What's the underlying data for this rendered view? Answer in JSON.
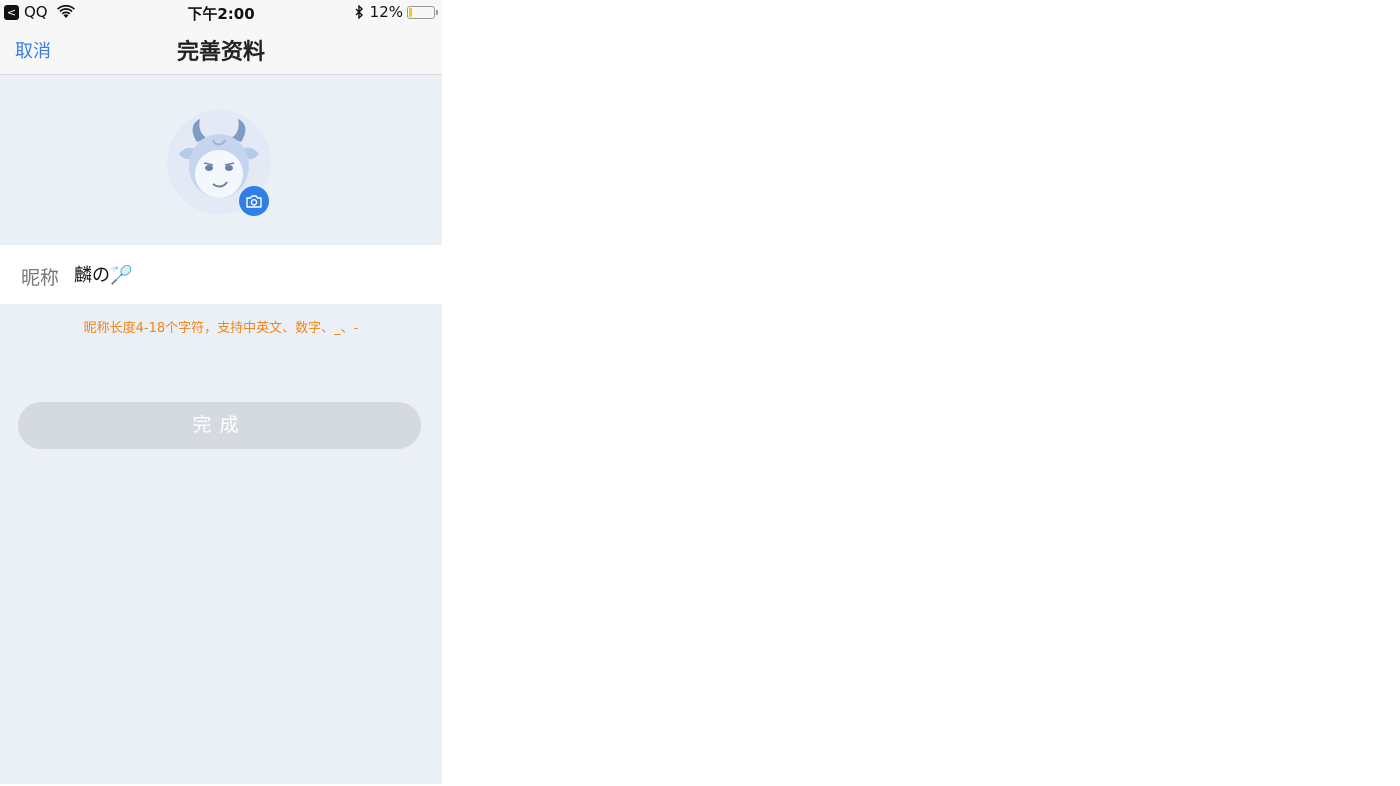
{
  "status_bar": {
    "back_app": "QQ",
    "back_glyph": "<",
    "time": "下午2:00",
    "battery_percent_text": "12%",
    "battery_level": 0.12,
    "battery_color": "#f5c51a"
  },
  "nav": {
    "cancel_label": "取消",
    "title": "完善资料"
  },
  "avatar": {
    "icon": "default-bull-avatar",
    "camera_icon": "camera-icon"
  },
  "nickname": {
    "label": "昵称",
    "value": "麟の🏸"
  },
  "hint": "昵称长度4-18个字符，支持中英文、数字、_、-",
  "done_button": {
    "label": "完成",
    "enabled": false
  },
  "colors": {
    "accent": "#3a7de0",
    "camera_button": "#2f7fe6",
    "hint": "#f08418",
    "background": "#ebeff6",
    "disabled_button": "#d5d9e0"
  }
}
